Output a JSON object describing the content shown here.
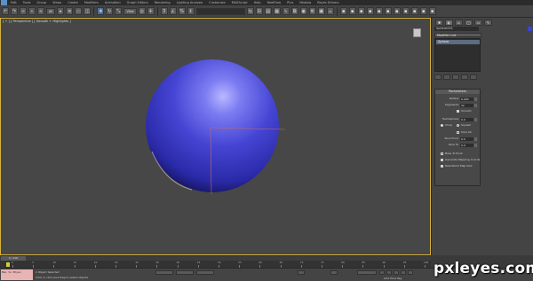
{
  "menubar": {
    "items": [
      "Edit",
      "Tools",
      "Group",
      "Views",
      "Create",
      "Modifiers",
      "Animation",
      "Graph Editors",
      "Rendering",
      "Lighting Analysis",
      "Customize",
      "MAXScript",
      "Help",
      "RealFlow",
      "Plus",
      "Nhalow",
      "Reyes Drivers"
    ]
  },
  "toolbar": {
    "selection_filter": "All",
    "named_selection": ""
  },
  "viewport": {
    "label": "[ + ] [ Perspective ] [ Smooth + Highlights ]",
    "sphere_color": "#3c3ccf",
    "border_color": "#d6b23a"
  },
  "command_panel": {
    "object_name": "Sphere001",
    "object_color": "#3a44d6",
    "modifier_list": "Modifier List",
    "stack_item": "Sphere",
    "rollout_title": "Parameters",
    "radius_label": "Radius:",
    "radius_value": "0.000",
    "segments_label": "Segments:",
    "segments_value": "32",
    "smooth_label": "Smooth",
    "hemisphere_label": "Hemisphere:",
    "hemisphere_value": "0.0",
    "chop_label": "Chop",
    "squash_label": "Squash",
    "slice_on_label": "Slice On",
    "slice_from_label": "Slice From:",
    "slice_from_value": "0.0",
    "slice_to_label": "Slice To:",
    "slice_to_value": "0.0",
    "base_to_pivot_label": "Base To Pivot",
    "gen_mapping_label": "Generate Mapping Coords.",
    "real_world_label": "Real-World Map Size"
  },
  "timeline": {
    "slider_label": "0 / 100",
    "ticks": [
      "0",
      "5",
      "10",
      "15",
      "20",
      "25",
      "30",
      "35",
      "40",
      "45",
      "50",
      "55",
      "60",
      "65",
      "70",
      "75",
      "80",
      "85",
      "90",
      "95",
      "100"
    ]
  },
  "status": {
    "maxscript_text": "Max to Physx",
    "line1": "1 Object Selected",
    "line2": "Click or click-and-drag to select objects",
    "add_time_tag": "Add Time Tag"
  },
  "watermark": "pxleyes.com"
}
